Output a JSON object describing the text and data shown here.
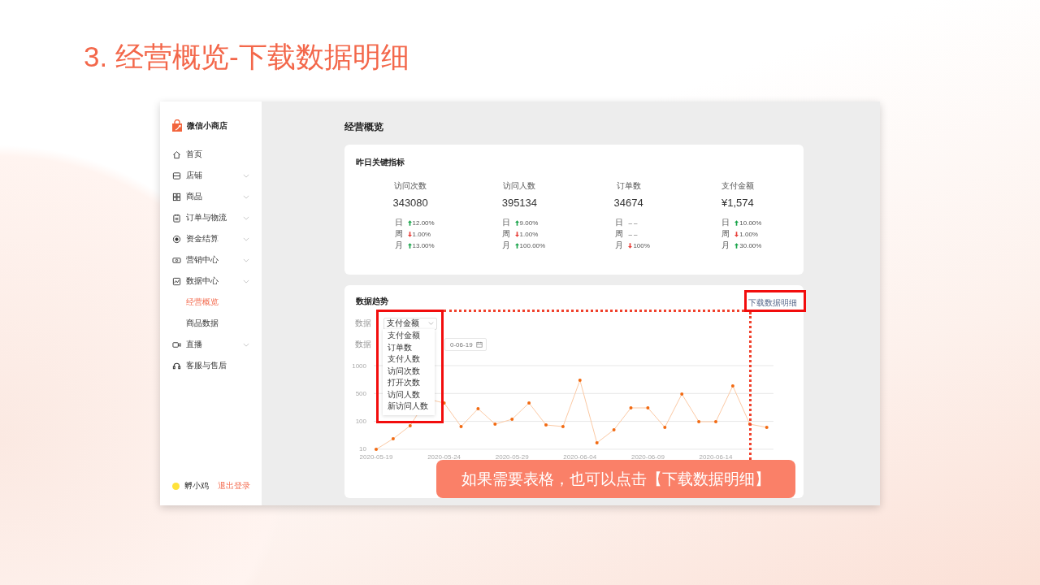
{
  "slide_title": "3. 经营概览-下载数据明细",
  "app": {
    "name": "微信小商店",
    "nav": [
      {
        "label": "首页",
        "expandable": false,
        "selected": false
      },
      {
        "label": "店铺",
        "expandable": true,
        "selected": false
      },
      {
        "label": "商品",
        "expandable": true,
        "selected": false
      },
      {
        "label": "订单与物流",
        "expandable": true,
        "selected": false
      },
      {
        "label": "资金结算",
        "expandable": true,
        "selected": false
      },
      {
        "label": "营销中心",
        "expandable": true,
        "selected": false
      },
      {
        "label": "数据中心",
        "expandable": true,
        "selected": false,
        "children": [
          {
            "label": "经营概览",
            "selected": true
          },
          {
            "label": "商品数据",
            "selected": false
          }
        ]
      },
      {
        "label": "直播",
        "expandable": true,
        "selected": false
      },
      {
        "label": "客服与售后",
        "expandable": false,
        "selected": false
      }
    ],
    "user": {
      "name": "孵小鸡",
      "color": "#ffe23a",
      "logout": "退出登录"
    }
  },
  "page_title": "经营概览",
  "key_metrics": {
    "title": "昨日关键指标",
    "metrics": [
      {
        "label": "访问次数",
        "value": "343080",
        "changes": [
          {
            "period": "日",
            "kind": "up",
            "text": "12.00%"
          },
          {
            "period": "周",
            "kind": "down",
            "text": "1.00%"
          },
          {
            "period": "月",
            "kind": "up",
            "text": "13.00%"
          }
        ]
      },
      {
        "label": "访问人数",
        "value": "395134",
        "changes": [
          {
            "period": "日",
            "kind": "up",
            "text": "9.00%"
          },
          {
            "period": "周",
            "kind": "down",
            "text": "1.00%"
          },
          {
            "period": "月",
            "kind": "up",
            "text": "100.00%"
          }
        ]
      },
      {
        "label": "订单数",
        "value": "34674",
        "changes": [
          {
            "period": "日",
            "kind": "flat",
            "text": "– –"
          },
          {
            "period": "周",
            "kind": "flat",
            "text": "– –"
          },
          {
            "period": "月",
            "kind": "down",
            "text": "100%"
          }
        ]
      },
      {
        "label": "支付金额",
        "value": "¥1,574",
        "changes": [
          {
            "period": "日",
            "kind": "up",
            "text": "10.00%"
          },
          {
            "period": "周",
            "kind": "down",
            "text": "1.00%"
          },
          {
            "period": "月",
            "kind": "up",
            "text": "30.00%"
          }
        ]
      }
    ]
  },
  "trend": {
    "title": "数据趋势",
    "download_link": "下载数据明细",
    "metric_label": "数据",
    "metric_select": "支付金额",
    "date_label": "数据",
    "date_value": "0-06-19",
    "dropdown_options": [
      "支付金额",
      "订单数",
      "支付人数",
      "访问次数",
      "打开次数",
      "访问人数",
      "新访问人数"
    ],
    "chart": {
      "y_labels": [
        "1000",
        "500",
        "100",
        "10"
      ],
      "x_labels": [
        "2020-05-19",
        "2020-05-24",
        "2020-05-29",
        "2020-06-04",
        "2020-06-09",
        "2020-06-14"
      ]
    }
  },
  "callout": "如果需要表格，也可以点击【下载数据明细】"
}
